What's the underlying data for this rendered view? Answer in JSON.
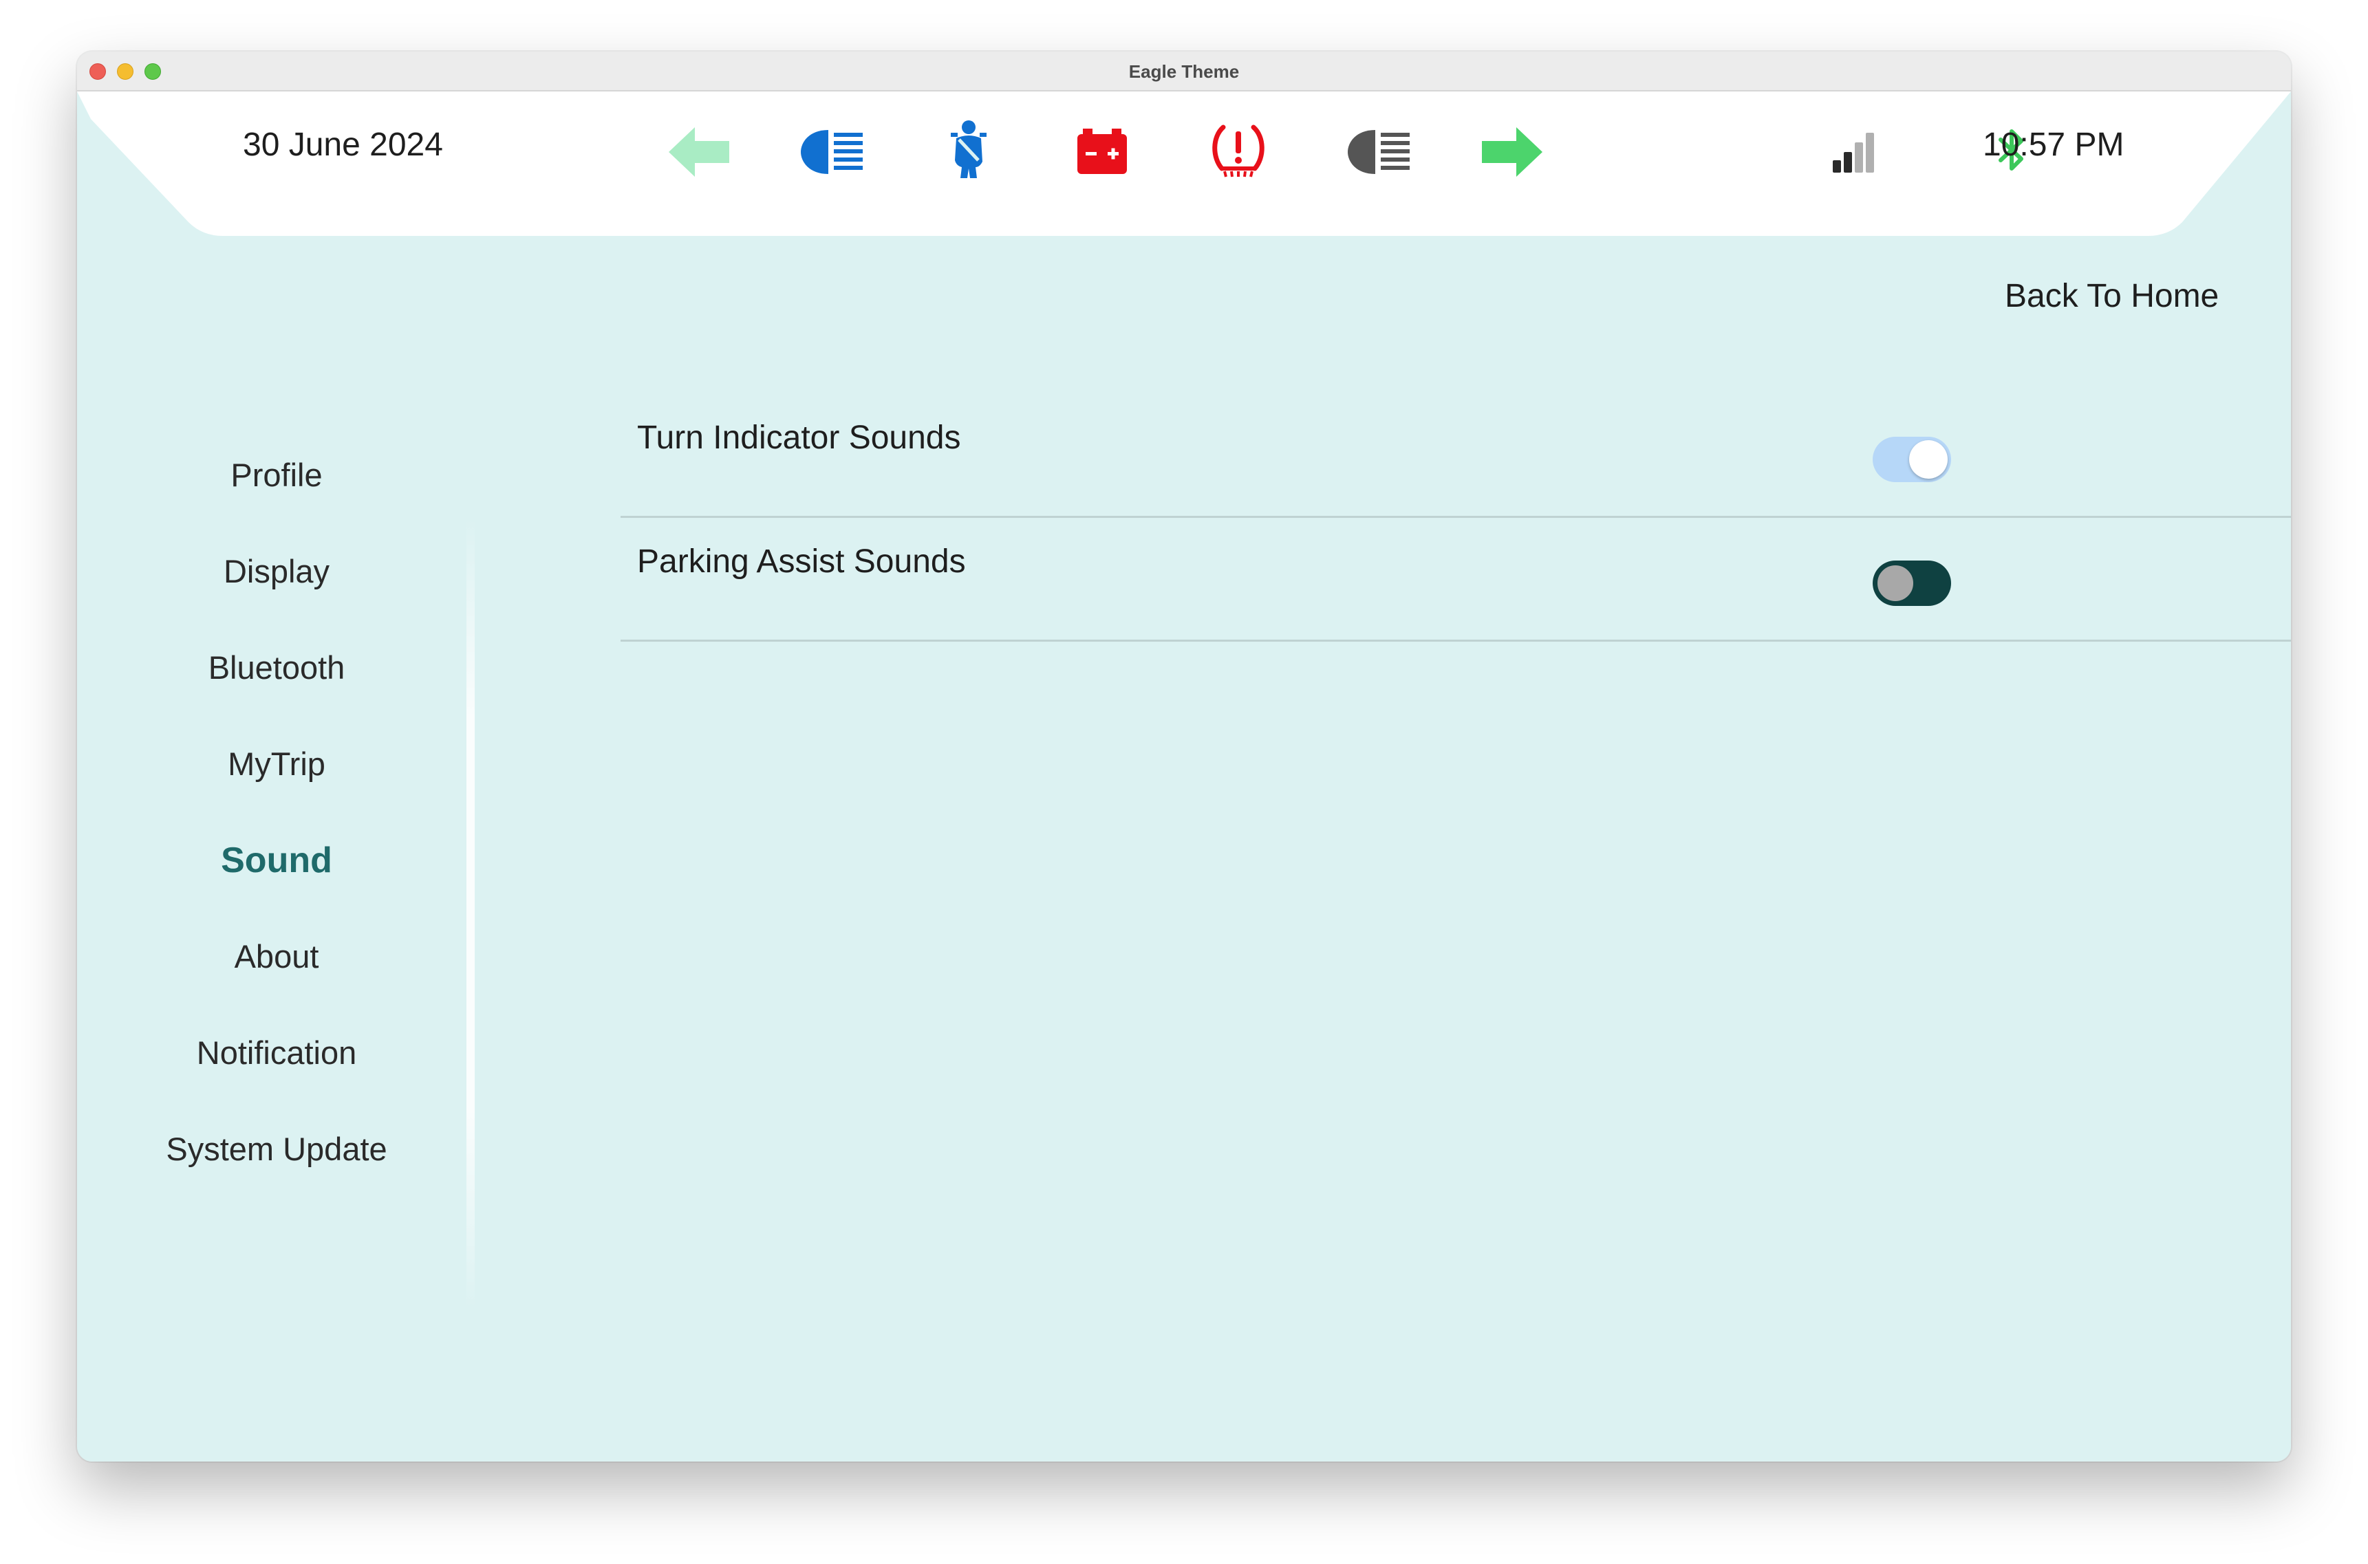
{
  "window": {
    "title": "Eagle Theme"
  },
  "header": {
    "date": "30 June 2024",
    "time": "10:57 PM",
    "indicator_icons": [
      "left-turn-arrow-icon",
      "high-beam-headlight-icon",
      "seatbelt-icon",
      "battery-warning-icon",
      "tire-pressure-warning-icon",
      "low-beam-headlight-icon",
      "right-turn-arrow-icon"
    ],
    "status_icons": [
      "signal-strength-icon",
      "bluetooth-icon"
    ],
    "colors": {
      "turn_left_dim": "#a9ecc4",
      "turn_right": "#4cd46c",
      "headlight_blue": "#1170d0",
      "warning_red": "#e8101a",
      "low_beam_gray": "#555555",
      "bluetooth_green": "#3cc75a"
    }
  },
  "back_link": {
    "label": "Back To Home"
  },
  "sidebar": {
    "items": [
      {
        "label": "Profile"
      },
      {
        "label": "Display"
      },
      {
        "label": "Bluetooth"
      },
      {
        "label": "MyTrip"
      },
      {
        "label": "Sound",
        "active": true
      },
      {
        "label": "About"
      },
      {
        "label": "Notification"
      },
      {
        "label": "System Update"
      }
    ],
    "active_color": "#1f6a6a"
  },
  "settings": [
    {
      "label": "Turn Indicator Sounds",
      "enabled": true
    },
    {
      "label": "Parking Assist Sounds",
      "enabled": false
    }
  ],
  "colors": {
    "background": "#dcf2f2",
    "header": "#ffffff",
    "toggle_on_track": "#b6d7f8",
    "toggle_off_track": "#0f4141"
  }
}
